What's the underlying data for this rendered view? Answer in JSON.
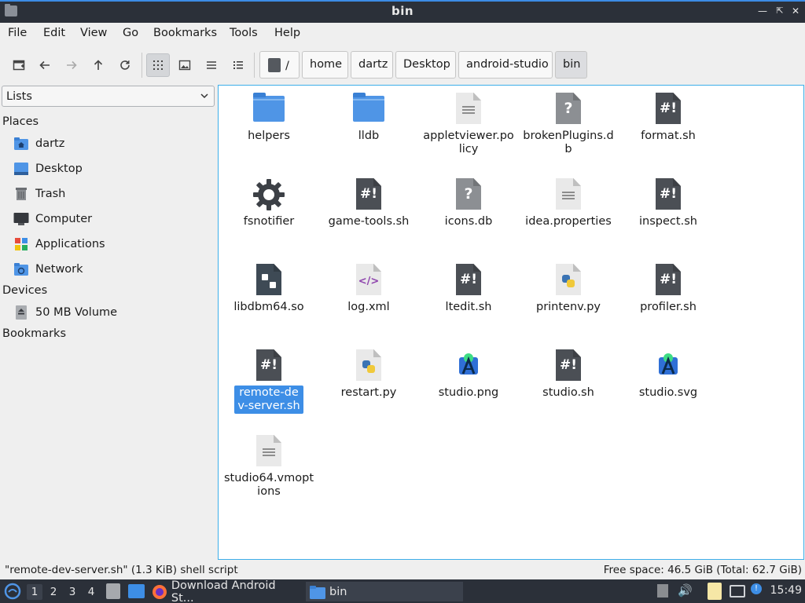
{
  "window": {
    "title": "bin"
  },
  "menu": [
    "File",
    "Edit",
    "View",
    "Go",
    "Bookmarks",
    "Tools",
    "Help"
  ],
  "path": [
    "/",
    "home",
    "dartz",
    "Desktop",
    "android-studio",
    "bin"
  ],
  "sidebar": {
    "selector": "Lists",
    "places_heading": "Places",
    "places": [
      {
        "label": "dartz",
        "icon": "home-folder-icon"
      },
      {
        "label": "Desktop",
        "icon": "desktop-icon"
      },
      {
        "label": "Trash",
        "icon": "trash-icon"
      },
      {
        "label": "Computer",
        "icon": "computer-icon"
      },
      {
        "label": "Applications",
        "icon": "applications-icon"
      },
      {
        "label": "Network",
        "icon": "network-icon"
      }
    ],
    "devices_heading": "Devices",
    "devices": [
      {
        "label": "50 MB Volume",
        "icon": "drive-icon"
      }
    ],
    "bookmarks_heading": "Bookmarks"
  },
  "files": [
    {
      "name": "helpers",
      "type": "folder"
    },
    {
      "name": "lldb",
      "type": "folder"
    },
    {
      "name": "appletviewer.policy",
      "type": "text"
    },
    {
      "name": "brokenPlugins.db",
      "type": "unknown"
    },
    {
      "name": "format.sh",
      "type": "script"
    },
    {
      "name": "fsnotifier",
      "type": "executable"
    },
    {
      "name": "game-tools.sh",
      "type": "script"
    },
    {
      "name": "icons.db",
      "type": "unknown"
    },
    {
      "name": "idea.properties",
      "type": "text"
    },
    {
      "name": "inspect.sh",
      "type": "script"
    },
    {
      "name": "libdbm64.so",
      "type": "library"
    },
    {
      "name": "log.xml",
      "type": "xml"
    },
    {
      "name": "ltedit.sh",
      "type": "script"
    },
    {
      "name": "printenv.py",
      "type": "python"
    },
    {
      "name": "profiler.sh",
      "type": "script"
    },
    {
      "name": "remote-dev-server.sh",
      "type": "script",
      "selected": true
    },
    {
      "name": "restart.py",
      "type": "python"
    },
    {
      "name": "studio.png",
      "type": "image"
    },
    {
      "name": "studio.sh",
      "type": "script"
    },
    {
      "name": "studio.svg",
      "type": "image"
    },
    {
      "name": "studio64.vmoptions",
      "type": "text"
    }
  ],
  "status": {
    "selection": "\"remote-dev-server.sh\" (1.3 KiB) shell script",
    "free_space": "Free space: 46.5 GiB (Total: 62.7 GiB)"
  },
  "taskbar": {
    "workspaces": [
      "1",
      "2",
      "3",
      "4"
    ],
    "tasks": [
      {
        "label": "Download Android St...",
        "icon": "firefox-icon"
      },
      {
        "label": "bin",
        "icon": "folder-icon"
      }
    ],
    "clock": "15:49"
  },
  "colors": {
    "accent": "#3d8ee6",
    "titlebar": "#2b3039",
    "folder": "#4f95e6"
  }
}
